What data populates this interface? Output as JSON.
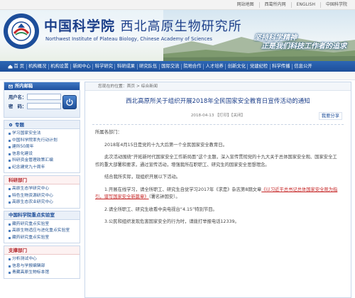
{
  "utility_links": [
    "网站地图",
    "西葛所内网",
    "ENGLISH",
    "中国科学院"
  ],
  "header": {
    "title_cn_script": "中国科学院",
    "title_cn_inst": "西北高原生物研究所",
    "title_en": "Northwest Institute of Plateau Biology, Chinese Academy of Sciences",
    "slogan_line1": "坚持科学精神",
    "slogan_line2": "正是我们科技工作者的追求"
  },
  "nav": [
    "首 页",
    "机构概况",
    "机构设置",
    "新闻中心",
    "科学研究",
    "科研成果",
    "研究队伍",
    "国际交流",
    "院地合作",
    "人才培养",
    "创新文化",
    "党建纪检",
    "科学传播",
    "信息公开"
  ],
  "sidebar": {
    "login": {
      "title": "所内邮箱",
      "user_label": "用户名：",
      "password_label": "密　码："
    },
    "topics": {
      "title": "专题",
      "items": [
        "学习国家安全法",
        "中国科学院率先行动计划",
        "建所50周年",
        "信息化建设",
        "科研资金管理政策汇编",
        "纪念建党九十周年"
      ]
    },
    "research_depts": {
      "title": "科研部门",
      "items": [
        "高原生态学研究中心",
        "特色生物资源研究中心",
        "高原生态农业研究中心"
      ]
    },
    "key_labs": {
      "title": "中国科学院重点实验室",
      "items": [
        "藏药研究重点实验室",
        "高原生物适应与进化重点实验室",
        "藏药研究重点实验室"
      ]
    },
    "support_depts": {
      "title": "支撑部门",
      "items": [
        "分析测试中心",
        "信息与学报编辑部",
        "青藏高原生物标本馆"
      ]
    }
  },
  "article": {
    "breadcrumb": "您现在的位置：首页 > 综合新闻",
    "title": "西北高原所关于组织开展2018年全民国家安全教育日宣传活动的通知",
    "date": "2018-04-13",
    "extra": "【打印】【关闭】",
    "share": "我要分享",
    "salutation": "所属各部门：",
    "paragraphs": [
      "2018年4月15日是党的十九大后第一个全民国家安全教育日。",
      "此次活动围绕“开拓新时代国家安全工作新局面”这个主题，深入宣传贯彻党的十九大关于总体国家安全观、国家安全工作的重大部署和要求，通过宣传活动，增强我所在职职工、研究生的国家安全思想理念。",
      "结合我所实际，现组织开展以下活动。",
      "1.开展在线学习，请全所职工、研究生自觉学习2017年《求是》杂志第8期文章",
      "2.请全所职工、研究生收看中央电视台“4.15”特别节目。",
      "3.公民和组织发现危害国家安全的行为时，请拨打举报电话12339。"
    ],
    "highlight": "《以习近平总书记总体国家安全观为指引，谱写国家安全新篇章》",
    "highlight_suffix": "（署名钟国安）。"
  },
  "colors": {
    "primary_blue": "#1d4e9a",
    "title_blue": "#1c3f8a",
    "accent_red": "#c62828"
  }
}
